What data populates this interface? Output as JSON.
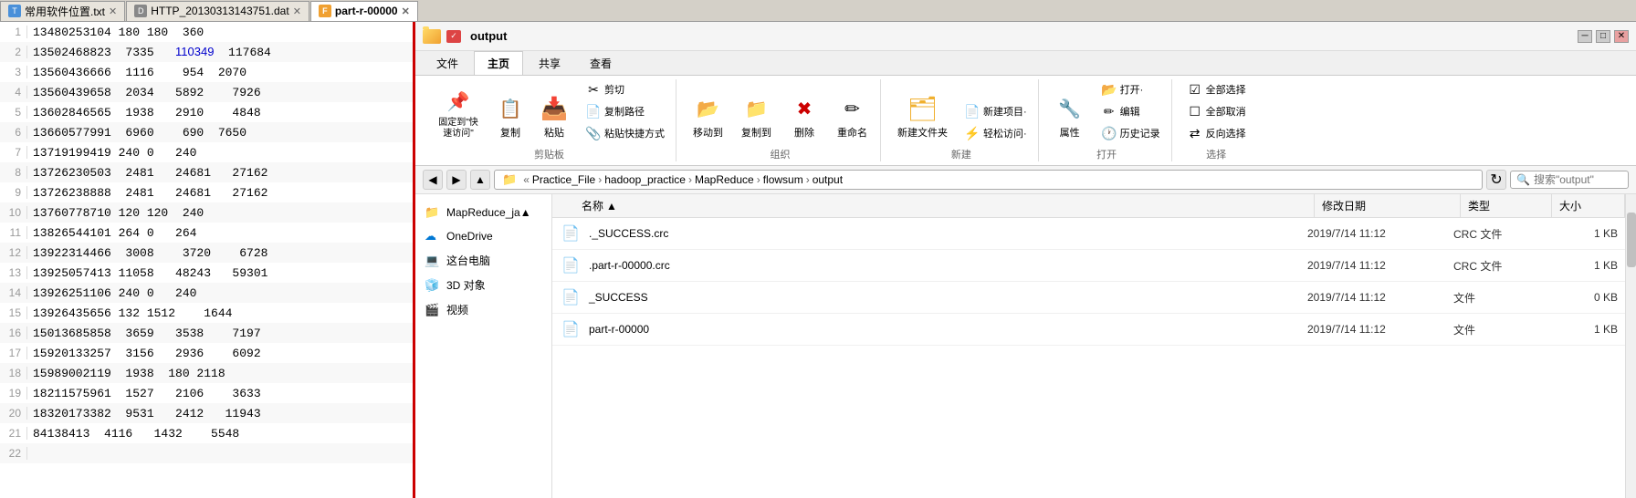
{
  "tabs": [
    {
      "label": "常用软件位置.txt",
      "type": "txt",
      "active": false
    },
    {
      "label": "HTTP_20130313143751.dat",
      "type": "dat",
      "active": false
    },
    {
      "label": "part-r-00000",
      "type": "file",
      "active": true
    }
  ],
  "editor": {
    "lines": [
      {
        "num": 1,
        "content": "13480253104 180 180  360"
      },
      {
        "num": 2,
        "content": "13502468823  7335   110349  117684"
      },
      {
        "num": 3,
        "content": "13560436666  1116    954  2070"
      },
      {
        "num": 4,
        "content": "13560439658  2034   5892    7926"
      },
      {
        "num": 5,
        "content": "13602846565  1938   2910    4848"
      },
      {
        "num": 6,
        "content": "13660577991  6960    690  7650"
      },
      {
        "num": 7,
        "content": "13719199419 240 0   240"
      },
      {
        "num": 8,
        "content": "13726230503  2481   24681   27162"
      },
      {
        "num": 9,
        "content": "13726238888  2481   24681   27162"
      },
      {
        "num": 10,
        "content": "13760778710 120 120  240"
      },
      {
        "num": 11,
        "content": "13826544101 264 0   264"
      },
      {
        "num": 12,
        "content": "13922314466  3008    3720    6728"
      },
      {
        "num": 13,
        "content": "13925057413 11058   48243   59301"
      },
      {
        "num": 14,
        "content": "13926251106 240 0   240"
      },
      {
        "num": 15,
        "content": "13926435656 132 1512    1644"
      },
      {
        "num": 16,
        "content": "15013685858  3659   3538    7197"
      },
      {
        "num": 17,
        "content": "15920133257  3156   2936    6092"
      },
      {
        "num": 18,
        "content": "15989002119  1938  180 2118"
      },
      {
        "num": 19,
        "content": "18211575961  1527   2106    3633"
      },
      {
        "num": 20,
        "content": "18320173382  9531   2412   11943"
      },
      {
        "num": 21,
        "content": "84138413  4116   1432    5548"
      },
      {
        "num": 22,
        "content": ""
      }
    ]
  },
  "explorer": {
    "title": "output",
    "ribbon": {
      "tabs": [
        "文件",
        "主页",
        "共享",
        "查看"
      ],
      "active_tab": "主页",
      "groups": {
        "clipboard": {
          "label": "剪贴板",
          "pin_label": "固定到\"快速访问\"",
          "copy_label": "复制",
          "paste_label": "粘贴",
          "cut_label": "剪切",
          "copy_path_label": "复制路径",
          "paste_shortcut_label": "粘贴快捷方式"
        },
        "organize": {
          "label": "组织",
          "move_to_label": "移动到",
          "copy_to_label": "复制到",
          "delete_label": "删除",
          "rename_label": "重命名"
        },
        "new": {
          "label": "新建",
          "new_folder_label": "新建文件夹",
          "new_item_label": "新建项目·",
          "easy_access_label": "轻松访问·"
        },
        "open": {
          "label": "打开",
          "open_label": "打开·",
          "edit_label": "编辑",
          "history_label": "历史记录",
          "properties_label": "属性"
        },
        "select": {
          "label": "选择",
          "select_all_label": "全部选择",
          "select_none_label": "全部取消",
          "invert_label": "反向选择"
        }
      }
    },
    "address": {
      "path_parts": [
        "Practice_File",
        "hadoop_practice",
        "MapReduce",
        "flowsum",
        "output"
      ],
      "search_placeholder": "搜索\"output\""
    },
    "sidebar": [
      {
        "label": "MapReduce_ja▲",
        "type": "folder"
      },
      {
        "label": "OneDrive",
        "type": "onedrive"
      },
      {
        "label": "这台电脑",
        "type": "computer"
      },
      {
        "label": "3D 对象",
        "type": "3d"
      },
      {
        "label": "视频",
        "type": "video"
      }
    ],
    "columns": [
      "名称",
      "修改日期",
      "类型",
      "大小"
    ],
    "files": [
      {
        "name": "._SUCCESS.crc",
        "date": "2019/7/14 11:12",
        "type": "CRC 文件",
        "size": "1 KB"
      },
      {
        "name": ".part-r-00000.crc",
        "date": "2019/7/14 11:12",
        "type": "CRC 文件",
        "size": "1 KB"
      },
      {
        "name": "_SUCCESS",
        "date": "2019/7/14 11:12",
        "type": "文件",
        "size": "0 KB"
      },
      {
        "name": "part-r-00000",
        "date": "2019/7/14 11:12",
        "type": "文件",
        "size": "1 KB"
      }
    ]
  }
}
